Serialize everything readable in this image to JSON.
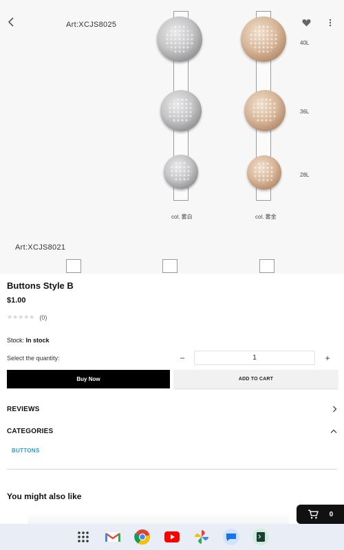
{
  "hero": {
    "art_top": "Art:XCJS8025",
    "art_bottom": "Art:XCJS8021",
    "sizes": [
      "40L",
      "36L",
      "28L"
    ],
    "col_silver": "col. 雾白",
    "col_gold": "col. 雾金"
  },
  "product": {
    "title": "Buttons Style B",
    "price": "$1.00",
    "rating_stars": "★★★★★",
    "rating_count": "(0)",
    "stock_label": "Stock:",
    "stock_value": "In stock",
    "qty_label": "Select the quantity:",
    "qty_value": "1",
    "qty_minus": "−",
    "qty_plus": "+"
  },
  "actions": {
    "buy_now": "Buy Now",
    "add_to_cart": "ADD TO CART"
  },
  "sections": {
    "reviews": "REVIEWS",
    "categories": "CATEGORIES",
    "category_link": "BUTTONS",
    "also_like": "You might also like"
  },
  "cart": {
    "count": "0"
  },
  "dock": {
    "apps": [
      "app-launcher-icon",
      "gmail-icon",
      "chrome-icon",
      "youtube-icon",
      "photos-icon",
      "messages-icon",
      "terminal-icon"
    ]
  },
  "colors": {
    "accent_link": "#2aa0c8",
    "buy_now_bg": "#000000",
    "dock_bg": "#e9eef6"
  }
}
